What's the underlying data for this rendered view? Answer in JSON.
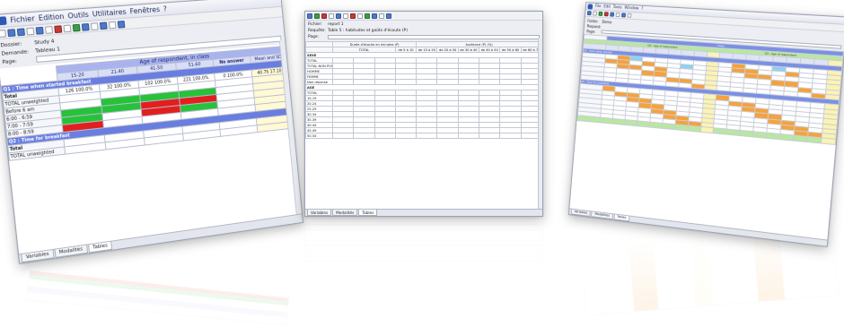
{
  "panel1": {
    "menu": [
      "Fichier",
      "Edition",
      "Outils",
      "Utilitaires",
      "Fenêtres",
      "?"
    ],
    "form": {
      "dossier_label": "Dossier:",
      "dossier_value": "Study 4",
      "demande_label": "Demande:",
      "demande_value": "Tableau 1",
      "page_label": "Page:"
    },
    "header": {
      "span_label": "Age of respondent, in class",
      "columns": [
        "15-20",
        "21-40",
        "41-50",
        "51-60",
        "No answer",
        "Mean and SD"
      ]
    },
    "section1": "Q1 : Time when started breakfast",
    "section2": "Q2 : Time for breakfast",
    "rows1": [
      "Total",
      "TOTAL unweighted",
      "Before 6 am",
      "6:00 - 6:59",
      "7:00 - 7:59",
      "8:00 - 8:59"
    ],
    "rows2": [
      "Total",
      "TOTAL unweighted"
    ],
    "cells": {
      "c1": "126",
      "p1": "100.0%",
      "c2": "32",
      "p2": "100.0%",
      "c3": "102",
      "p3": "100.0%",
      "c4": "221",
      "p4": "100.0%",
      "c5": "0",
      "p5": "100.0%",
      "mean": "40.75",
      "sd": "17.10"
    },
    "tabs": [
      "Variables",
      "Modalités",
      "Tables"
    ],
    "active_tab": "Tables"
  },
  "panel2": {
    "form": {
      "title_label": "Fichier:",
      "title_value": "report 1",
      "req_label": "Requête:",
      "req_value": "Table 5 : habitudes et goûts d'écoute (P)",
      "page_label": "Page:"
    },
    "header_a": "Durée d'écoute en minutes (P)",
    "header_b": "Audience (P) (%)",
    "col_labels": [
      "TOTAL",
      "de 5 à 10",
      "de 10 à 20",
      "de 20 à 30",
      "de 30 à 40",
      "de 40 à 50",
      "de 50 à 60",
      "de 60 à 70"
    ],
    "sec_a": "SEXE",
    "sec_b": "AGE",
    "rows_a": [
      "TOTAL",
      "TOTAL NON POSITIFS",
      "HOMME",
      "FEMME",
      "Non-réponse"
    ],
    "rows_b": [
      "TOTAL",
      "15-19",
      "20-24",
      "25-29",
      "30-34",
      "35-39",
      "40-44",
      "45-49",
      "50-54"
    ],
    "tabs": [
      "Variables",
      "Modalités",
      "Tables"
    ],
    "active_tab": "Tables"
  },
  "panel3": {
    "menu": [
      "File",
      "Edit",
      "Tools",
      "Window",
      "?"
    ],
    "form": {
      "folder_label": "Folder:",
      "folder_value": "Demo",
      "request_label": "Request:",
      "page_label": "Page:"
    },
    "title_band": "Class",
    "sub_band_left": "Q3 : Age of respondent",
    "sub_band_right": "Q3 : Age of respondent",
    "sec1": "Q5 : Time when started",
    "sec2": "Q6 : Time for breakfast",
    "tabs": [
      "Variables",
      "Modalities",
      "Tables"
    ],
    "active_tab": "Tables"
  },
  "colors": {
    "header_blue": "#a9b3ee",
    "section_blue": "#6a7ee0",
    "green_cell": "#27c23a",
    "red_cell": "#e21f1f",
    "orange_cell": "#f5a23c",
    "light_blue_cell": "#8fd0f0",
    "yellow_col": "#fbf3b4",
    "green_band": "#b9e7a1"
  }
}
